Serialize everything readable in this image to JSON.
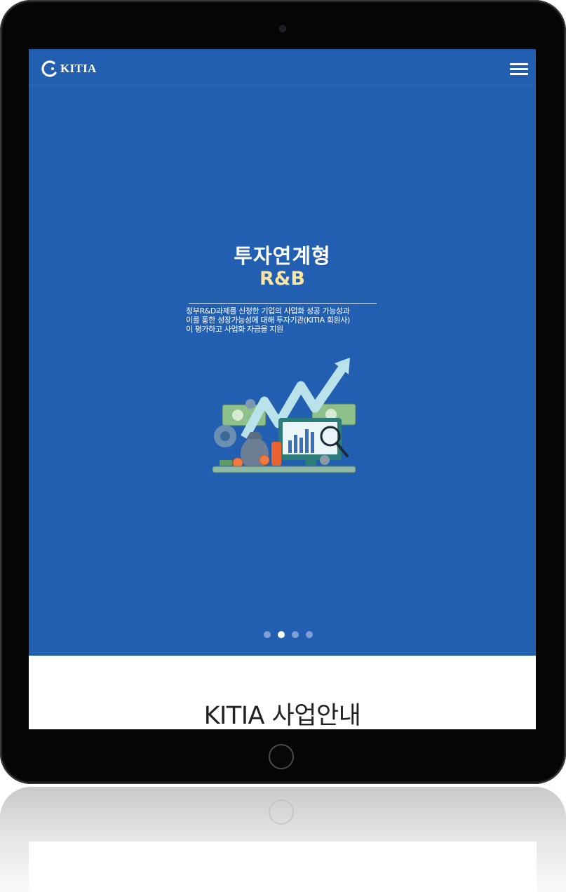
{
  "brand": {
    "logo_text": "KITIA"
  },
  "hero": {
    "title": "투자연계형",
    "subtitle": "R&B",
    "description": "정부R&D과제를 신청한 기업의 사업화 성공 가능성과\n이를 통한 성장가능성에 대해 투자기관(KITIA 회원사)\n이 평가하고 사업화 자금을 지원",
    "slide_indicator": {
      "count": 4,
      "active": 2
    }
  },
  "section": {
    "title": "KITIA 사업안내"
  },
  "icons": {
    "menu": "hamburger-menu-icon",
    "logo": "kitia-logo-icon",
    "illustration": "investment-growth-illustration"
  },
  "colors": {
    "hero_bg": "#235fb1",
    "subtitle": "#f8e6a0",
    "dot_active": "#ffffff",
    "dot_inactive": "#7fa0d6"
  }
}
